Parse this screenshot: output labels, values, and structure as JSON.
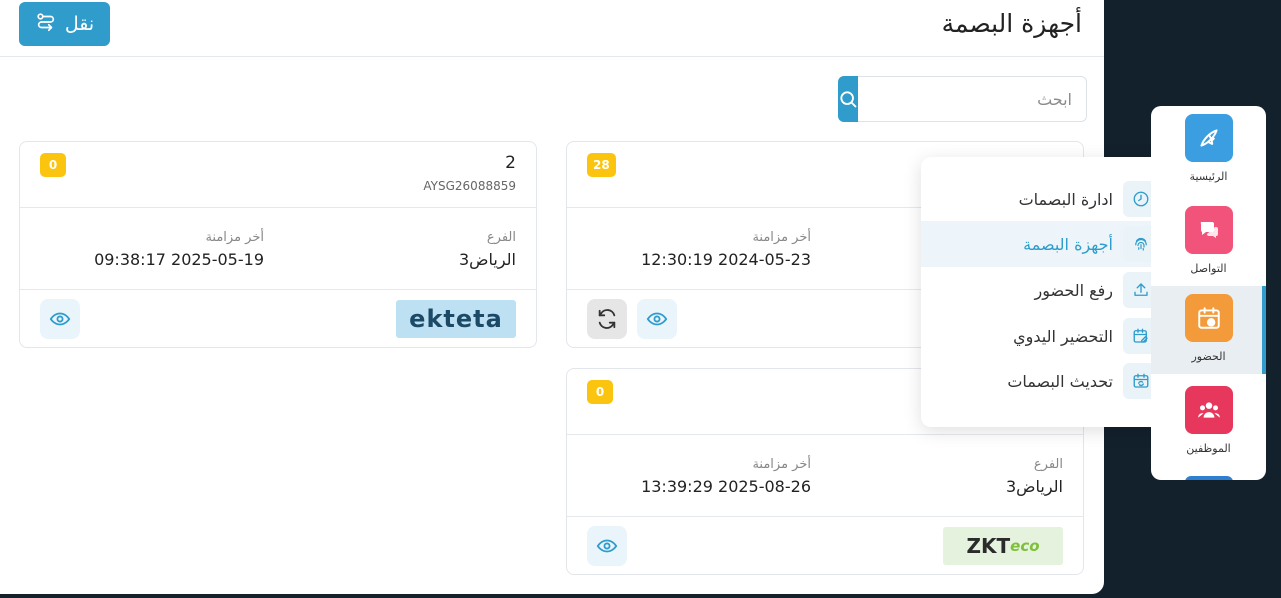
{
  "header": {
    "title": "أجهزة البصمة",
    "transfer_label": "نقل"
  },
  "search": {
    "placeholder": "ابحث"
  },
  "cards": [
    {
      "name": "2",
      "serial": "AYSG26088859",
      "badge": "0",
      "branch_label": "الفرع",
      "branch_value": "الرياض3",
      "sync_label": "أخر مزامنة",
      "sync_value": "09:38:17 2025-05-19",
      "brand": "ekteta"
    },
    {
      "badge": "28",
      "sync_label": "أخر مزامنة",
      "sync_value": "12:30:19 2024-05-23"
    },
    {
      "badge": "0",
      "branch_label": "الفرع",
      "branch_value": "الرياض3",
      "sync_label": "أخر مزامنة",
      "sync_value": "13:39:29 2025-08-26",
      "brand_main": "ZKT",
      "brand_suffix": "eco"
    }
  ],
  "dropdown": {
    "items": [
      {
        "label": "ادارة البصمات",
        "icon": "clock-icon",
        "active": false
      },
      {
        "label": "أجهزة البصمة",
        "icon": "fingerprint-icon",
        "active": true
      },
      {
        "label": "رفع الحضور",
        "icon": "upload-icon",
        "active": false
      },
      {
        "label": "التحضير اليدوي",
        "icon": "calendar-edit-icon",
        "active": false
      },
      {
        "label": "تحديث البصمات",
        "icon": "calendar-refresh-icon",
        "active": false
      }
    ]
  },
  "sidebar": {
    "items": [
      {
        "label": "الرئيسية",
        "icon": "home-icon",
        "color": "#3a9ee0"
      },
      {
        "label": "التواصل",
        "icon": "chat-icon",
        "color": "#f2537a"
      },
      {
        "label": "الحضور",
        "icon": "attendance-icon",
        "color": "#f39a3a"
      },
      {
        "label": "الموظفين",
        "icon": "employees-icon",
        "color": "#e8375d"
      }
    ]
  },
  "colors": {
    "primary": "#2f9ccb",
    "badge": "#fbc40f",
    "background": "#13212d"
  }
}
